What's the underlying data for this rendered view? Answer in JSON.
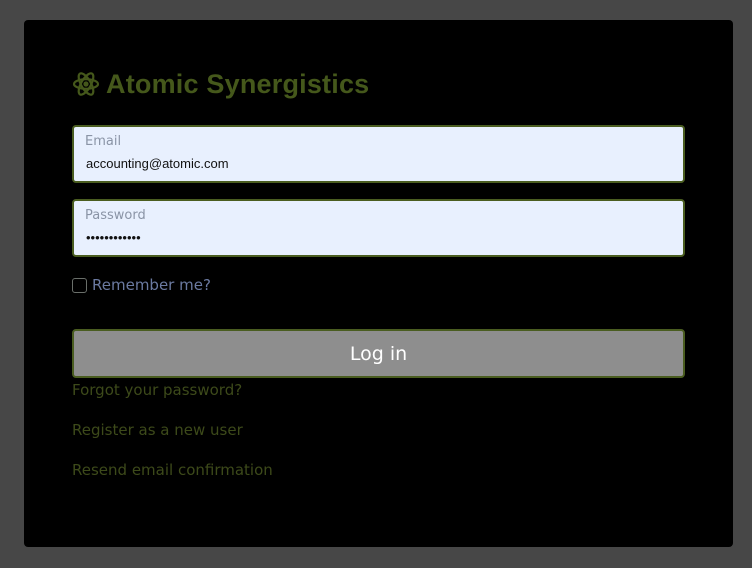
{
  "brand": {
    "title": "Atomic Synergistics",
    "icon": "atom-icon",
    "color": "#45581b"
  },
  "form": {
    "email": {
      "label": "Email",
      "value": "accounting@atomic.com"
    },
    "password": {
      "label": "Password",
      "value": "••••••••••••"
    },
    "remember_label": "Remember me?",
    "remember_checked": false,
    "login_label": "Log in"
  },
  "links": {
    "forgot": "Forgot your password?",
    "register": "Register as a new user",
    "resend": "Resend email confirmation"
  },
  "colors": {
    "page_bg": "#474747",
    "panel_bg": "#000000",
    "accent": "#45581b",
    "field_bg": "#e8f0fe",
    "button_bg": "#8e8e8e"
  }
}
